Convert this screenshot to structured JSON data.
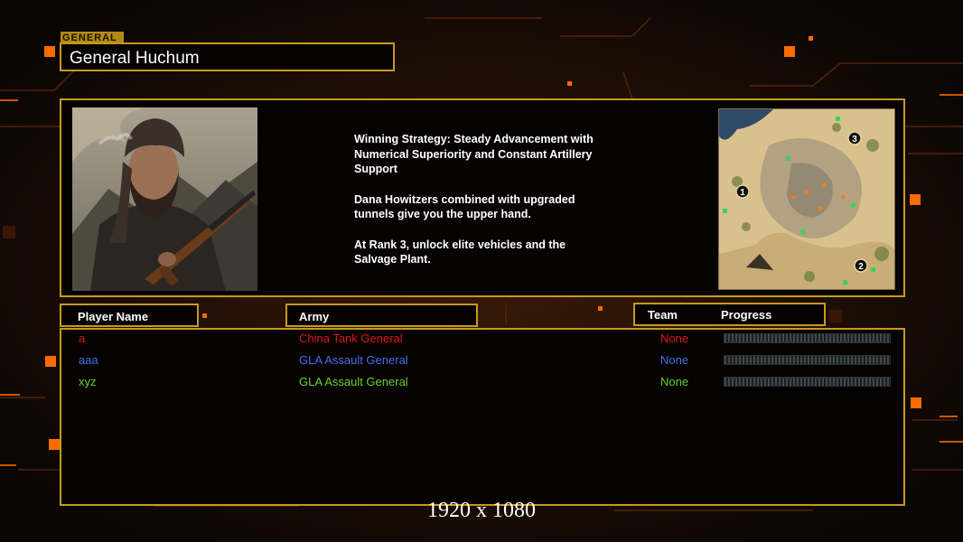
{
  "header": {
    "tag": "GENERAL",
    "title": "General Huchum"
  },
  "strategy": {
    "paragraphs": [
      "Winning Strategy: Steady Advancement with\n Numerical Superiority and Constant Artillery\n Support",
      "Dana Howitzers combined with upgraded\n tunnels give you the upper hand.",
      "At Rank 3, unlock elite vehicles and the\n Salvage Plant."
    ]
  },
  "minimap": {
    "markers": [
      "1",
      "2",
      "3"
    ]
  },
  "columns": {
    "player_name": "Player Name",
    "army": "Army",
    "team": "Team",
    "progress": "Progress"
  },
  "players": [
    {
      "name": "a",
      "army": "China Tank General",
      "team": "None",
      "color": "#e0161a",
      "progress": 0
    },
    {
      "name": "aaa",
      "army": "GLA Assault General",
      "team": "None",
      "color": "#4170ea",
      "progress": 0
    },
    {
      "name": "xyz",
      "army": "GLA Assault General",
      "team": "None",
      "color": "#63d42a",
      "progress": 0
    }
  ],
  "footer": {
    "resolution": "1920 x 1080"
  },
  "colors": {
    "frame": "#c79a1c",
    "accent": "#ff6a00"
  }
}
